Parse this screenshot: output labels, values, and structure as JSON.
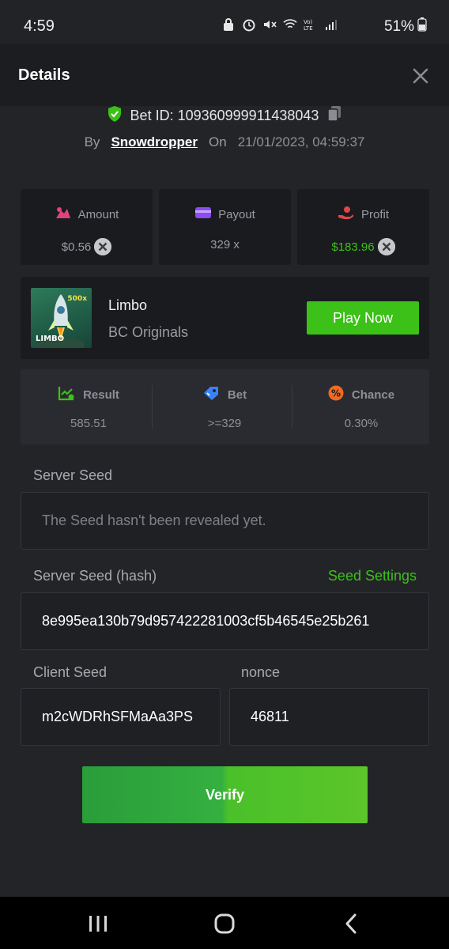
{
  "status_bar": {
    "time": "4:59",
    "battery_percent": "51%",
    "icons": [
      "lock-notification-icon",
      "alarm-icon",
      "mute-icon",
      "wifi-icon",
      "volte-icon",
      "signal-icon",
      "battery-icon"
    ]
  },
  "header": {
    "title": "Details"
  },
  "bet": {
    "id_label": "Bet ID: 109360999911438043",
    "by_label": "By",
    "user": "Snowdropper",
    "on_label": "On",
    "date": "21/01/2023, 04:59:37"
  },
  "stats": {
    "amount": {
      "label": "Amount",
      "value": "$0.56"
    },
    "payout": {
      "label": "Payout",
      "value": "329 x"
    },
    "profit": {
      "label": "Profit",
      "value": "$183.96"
    }
  },
  "game": {
    "name": "Limbo",
    "provider": "BC Originals",
    "thumb_badge": "500x",
    "thumb_logo": "LIMBO",
    "play_label": "Play Now"
  },
  "result": {
    "result": {
      "label": "Result",
      "value": "585.51"
    },
    "bet": {
      "label": "Bet",
      "value": ">=329"
    },
    "chance": {
      "label": "Chance",
      "value": "0.30%"
    }
  },
  "server_seed": {
    "label": "Server Seed",
    "placeholder": "The Seed hasn't been revealed yet."
  },
  "server_seed_hash": {
    "label": "Server Seed (hash)",
    "settings_link": "Seed Settings",
    "value": "8e995ea130b79d957422281003cf5b46545e25b261"
  },
  "client_seed": {
    "label": "Client Seed",
    "value": "m2cWDRhSFMaAa3PS"
  },
  "nonce": {
    "label": "nonce",
    "value": "46811"
  },
  "verify_label": "Verify",
  "colors": {
    "accent_green": "#3bc117",
    "profit_green": "#3bc117",
    "amount_pink": "#e2417a",
    "payout_purple": "#8b4cf2",
    "profit_red": "#e04646",
    "result_green": "#3bc117",
    "bet_blue": "#3a82f7",
    "chance_orange": "#f06a1f",
    "verified_green": "#3bc117"
  }
}
